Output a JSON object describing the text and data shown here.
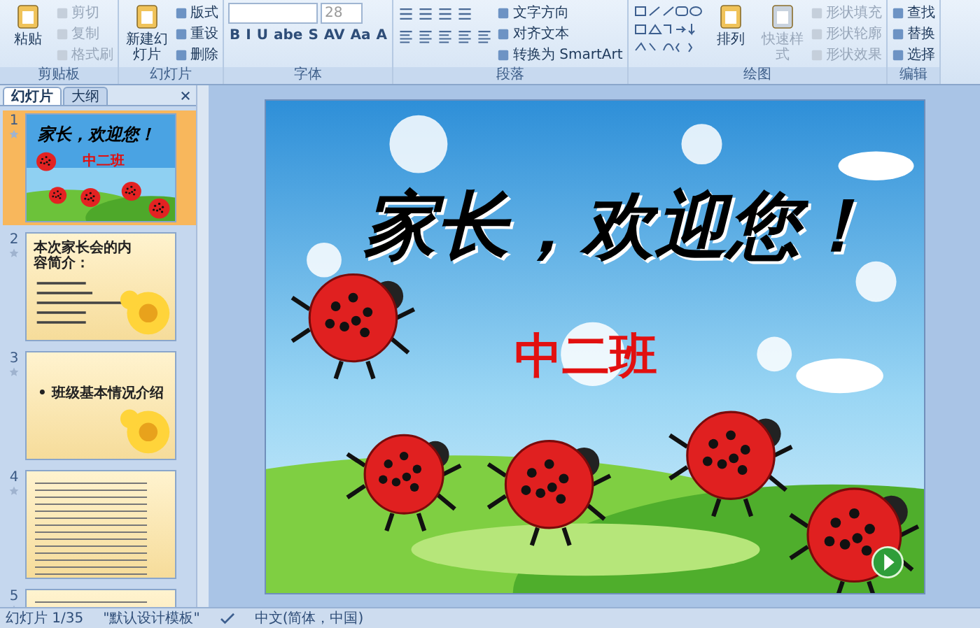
{
  "ribbon": {
    "groups": [
      {
        "label": "剪贴板",
        "columns": [
          [
            {
              "kind": "large",
              "label": "粘贴",
              "disabled": false
            }
          ],
          [
            {
              "kind": "small",
              "label": "剪切",
              "disabled": true
            },
            {
              "kind": "small",
              "label": "复制",
              "disabled": true
            },
            {
              "kind": "small",
              "label": "格式刷",
              "disabled": true
            }
          ]
        ]
      },
      {
        "label": "幻灯片",
        "columns": [
          [
            {
              "kind": "large",
              "label": "新建幻灯片",
              "disabled": false
            }
          ],
          [
            {
              "kind": "small",
              "label": "版式",
              "disabled": false
            },
            {
              "kind": "small",
              "label": "重设",
              "disabled": false
            },
            {
              "kind": "small",
              "label": "删除",
              "disabled": false
            }
          ]
        ]
      },
      {
        "label": "字体",
        "columns": [
          [
            {
              "kind": "fields",
              "value": "28"
            },
            {
              "kind": "glyphs",
              "glyphs": [
                "B",
                "I",
                "U",
                "abe",
                "S",
                "AV",
                "Aa",
                "A"
              ]
            }
          ]
        ]
      },
      {
        "label": "段落",
        "columns": [
          [
            {
              "kind": "list-tools"
            },
            {
              "kind": "align-tools"
            }
          ],
          [
            {
              "kind": "small",
              "label": "文字方向",
              "disabled": false
            },
            {
              "kind": "small",
              "label": "对齐文本",
              "disabled": false
            },
            {
              "kind": "small",
              "label": "转换为 SmartArt",
              "disabled": false
            }
          ]
        ]
      },
      {
        "label": "绘图",
        "columns": [
          [
            {
              "kind": "shapes"
            }
          ],
          [
            {
              "kind": "large",
              "label": "排列",
              "disabled": false
            }
          ],
          [
            {
              "kind": "large",
              "label": "快速样式",
              "disabled": true
            }
          ],
          [
            {
              "kind": "small",
              "label": "形状填充",
              "disabled": true
            },
            {
              "kind": "small",
              "label": "形状轮廓",
              "disabled": true
            },
            {
              "kind": "small",
              "label": "形状效果",
              "disabled": true
            }
          ]
        ]
      },
      {
        "label": "编辑",
        "columns": [
          [
            {
              "kind": "small",
              "label": "查找",
              "disabled": false
            },
            {
              "kind": "small",
              "label": "替换",
              "disabled": false
            },
            {
              "kind": "small",
              "label": "选择",
              "disabled": false
            }
          ]
        ]
      }
    ]
  },
  "panel": {
    "tabs": [
      {
        "label": "幻灯片",
        "selected": true
      },
      {
        "label": "大纲",
        "selected": false
      }
    ],
    "thumbnails": [
      {
        "number": "1",
        "selected": true,
        "kind": "title",
        "title": "家长，欢迎您！",
        "subtitle": "中二班"
      },
      {
        "number": "2",
        "selected": false,
        "kind": "list",
        "title": "本次家长会的内容简介："
      },
      {
        "number": "3",
        "selected": false,
        "kind": "section",
        "title": "• 班级基本情况介绍"
      },
      {
        "number": "4",
        "selected": false,
        "kind": "text"
      },
      {
        "number": "5",
        "selected": false,
        "kind": "text"
      }
    ]
  },
  "slide": {
    "title": "家长，欢迎您！",
    "subtitle": "中二班"
  },
  "status_bar": {
    "slide": "幻灯片 1/35",
    "theme": "\"默认设计模板\"",
    "language": "中文(简体，中国)"
  }
}
